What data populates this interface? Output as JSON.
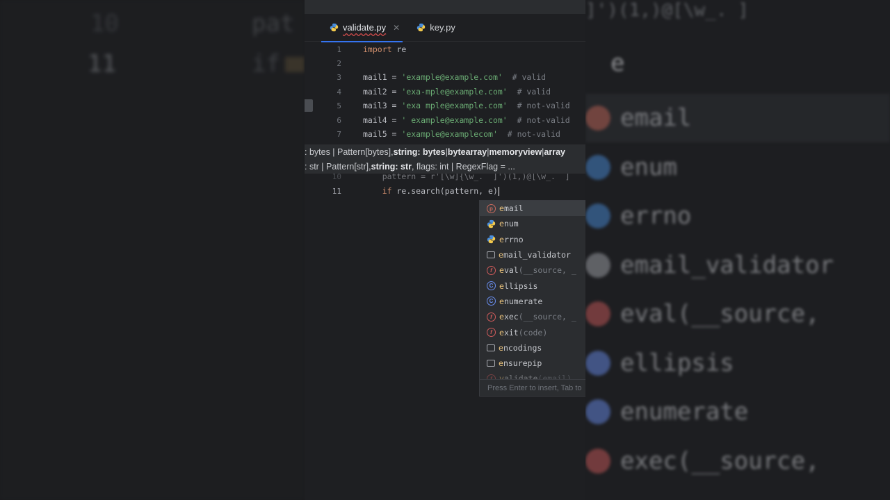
{
  "background_left": {
    "line_number_top": "10",
    "line_number_cur": "11",
    "code_top": "pat",
    "code_cur": "if"
  },
  "background_right": {
    "top_code": "]')(1,)@[\\w_.  ]",
    "cur_code": "e",
    "items": [
      {
        "label": "email",
        "kind": "p"
      },
      {
        "label": "enum",
        "kind": "py"
      },
      {
        "label": "errno",
        "kind": "py"
      },
      {
        "label": "email_validator",
        "kind": "folder"
      },
      {
        "label": "eval(__source,",
        "kind": "f"
      },
      {
        "label": "ellipsis",
        "kind": "c"
      },
      {
        "label": "enumerate",
        "kind": "c"
      },
      {
        "label": "exec(__source,",
        "kind": "f"
      }
    ]
  },
  "tabs": [
    {
      "label": "validate.py",
      "close": "✕"
    },
    {
      "label": "key.py"
    }
  ],
  "code": {
    "l1": {
      "num": "1",
      "kw": "import",
      "rest": " re"
    },
    "l2": {
      "num": "2"
    },
    "l3": {
      "num": "3",
      "lhs": "mail1 = ",
      "str": "'example@example.com'",
      "cmt": "  # valid"
    },
    "l4": {
      "num": "4",
      "lhs": "mail2 = ",
      "str": "'exa-mple@example.com'",
      "cmt": "  # valid"
    },
    "l5": {
      "num": "5",
      "lhs": "mail3 = ",
      "str": "'exa mple@example.com'",
      "cmt": "  # not-valid"
    },
    "l6": {
      "num": "6",
      "lhs": "mail4 = ",
      "str": "' example@example.com'",
      "cmt": "  # not-valid"
    },
    "l7": {
      "num": "7",
      "lhs": "mail5 = ",
      "str": "'example@examplecom'",
      "cmt": "  # not-valid"
    },
    "l10": {
      "num": "10",
      "text": "    pattern = r'[\\w]{\\w_.  ]')(1,)@[\\w_.  ]"
    },
    "l11": {
      "num": "11",
      "kw": "if",
      "rest": " re.search(pattern, e"
    }
  },
  "param_hints": {
    "row1": {
      "a": ": bytes | Pattern[bytes], ",
      "b": "string: bytes",
      "c": " | ",
      "d": "bytearray",
      "e": " | ",
      "f": "memoryview",
      "g": " | ",
      "h": "array"
    },
    "row2": {
      "a": ": str | Pattern[str], ",
      "b": "string: str",
      "c": ", flags: int | RegexFlag = ..."
    }
  },
  "completion": {
    "items": [
      {
        "match": "e",
        "rest": "mail",
        "tail": "",
        "icon": "p",
        "icon_glyph": "p"
      },
      {
        "match": "e",
        "rest": "num",
        "tail": "",
        "icon": "py",
        "icon_glyph": ""
      },
      {
        "match": "e",
        "rest": "rrno",
        "tail": "",
        "icon": "py",
        "icon_glyph": ""
      },
      {
        "match": "e",
        "rest": "mail_validator",
        "tail": "",
        "icon": "folder",
        "icon_glyph": ""
      },
      {
        "match": "e",
        "rest": "val",
        "tail": "(__source, _",
        "icon": "f",
        "icon_glyph": "f"
      },
      {
        "match": "e",
        "rest": "llipsis",
        "tail": "",
        "icon": "c",
        "icon_glyph": "C"
      },
      {
        "match": "e",
        "rest": "numerate",
        "tail": "",
        "icon": "c",
        "icon_glyph": "C"
      },
      {
        "match": "e",
        "rest": "xec",
        "tail": "(__source, _",
        "icon": "f",
        "icon_glyph": "f"
      },
      {
        "match": "e",
        "rest": "xit",
        "tail": "(code)",
        "icon": "f",
        "icon_glyph": "f"
      },
      {
        "match": "e",
        "rest": "ncodings",
        "tail": "",
        "icon": "folder",
        "icon_glyph": ""
      },
      {
        "match": "e",
        "rest": "nsurepip",
        "tail": "",
        "icon": "folder",
        "icon_glyph": ""
      },
      {
        "match": "v",
        "rest": "alidate",
        "tail": "(email)",
        "icon": "f",
        "icon_glyph": "f"
      }
    ],
    "footer": "Press Enter to insert, Tab to"
  },
  "colors": {
    "accent": "#3574f0",
    "keyword": "#cf8e6d",
    "string": "#6aab73",
    "comment": "#7a7e85",
    "match": "#e7c07a"
  }
}
